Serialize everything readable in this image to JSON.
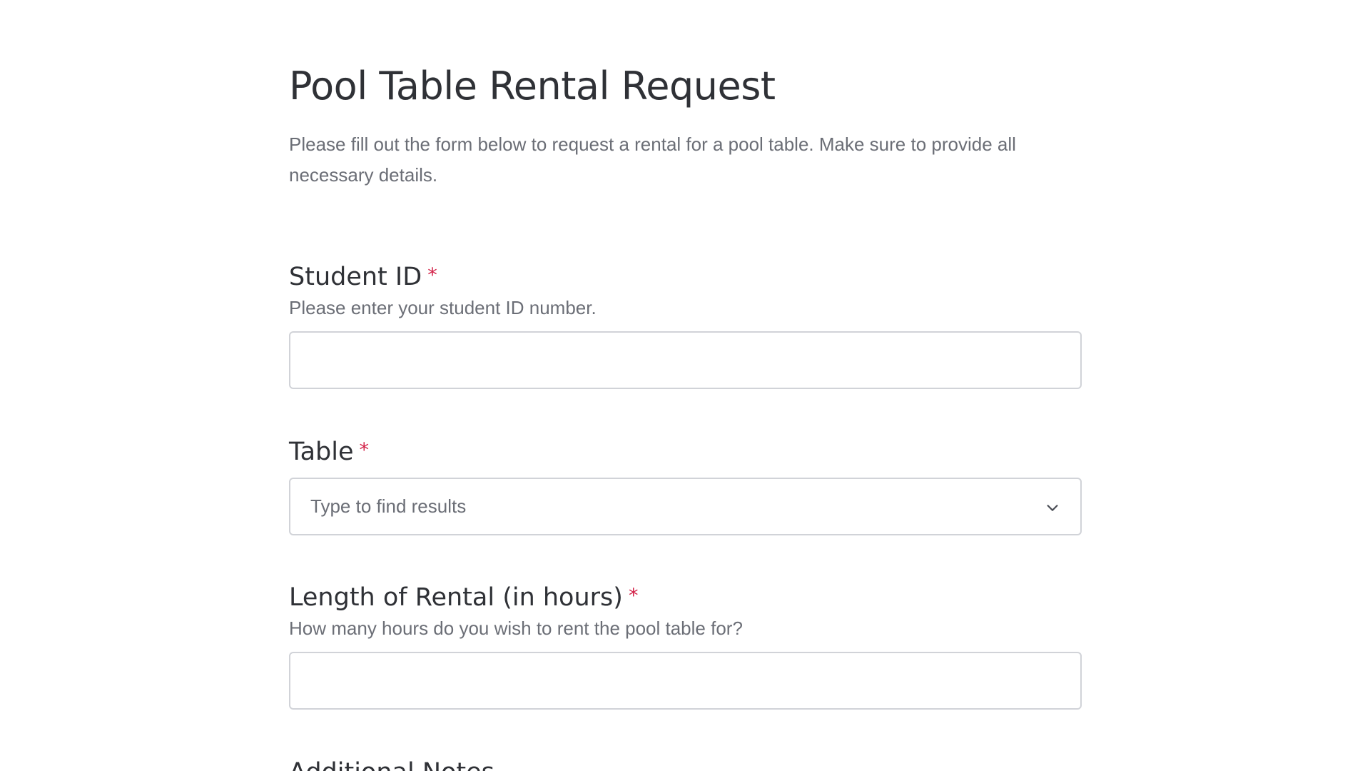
{
  "form": {
    "title": "Pool Table Rental Request",
    "description": "Please fill out the form below to request a rental for a pool table. Make sure to provide all necessary details.",
    "required_mark": "*",
    "fields": {
      "student_id": {
        "label": "Student ID",
        "help": "Please enter your student ID number.",
        "value": ""
      },
      "table": {
        "label": "Table",
        "placeholder": "Type to find results",
        "icon": "chevron-down-icon"
      },
      "length": {
        "label": "Length of Rental (in hours)",
        "help": "How many hours do you wish to rent the pool table for?",
        "value": ""
      },
      "notes": {
        "label": "Additional Notes"
      }
    }
  },
  "colors": {
    "text": "#2f3136",
    "muted": "#6b6e76",
    "required": "#d3244a",
    "border": "#d1d3d8"
  }
}
